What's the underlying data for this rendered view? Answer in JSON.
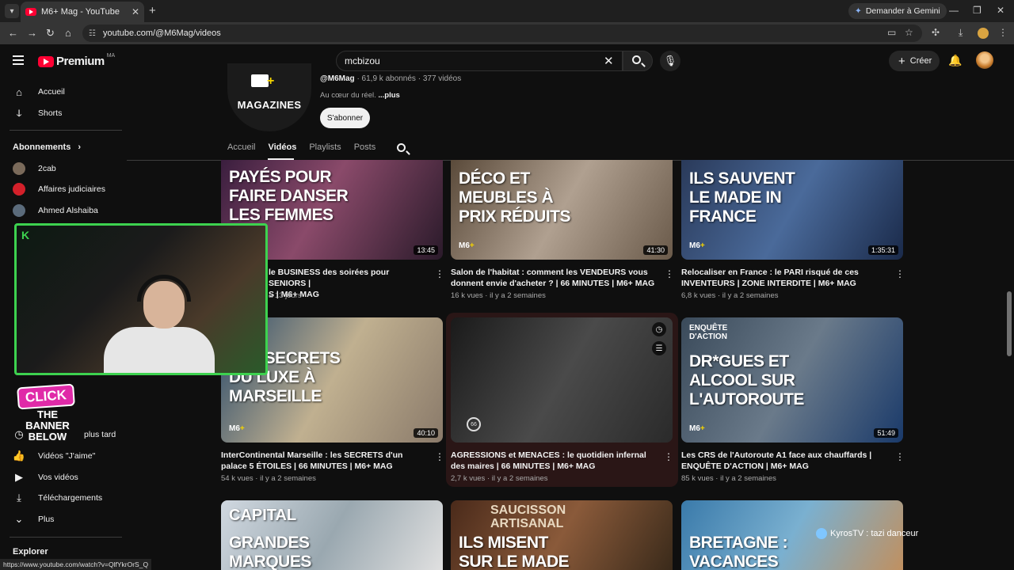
{
  "browser": {
    "tab_title": "M6+ Mag - YouTube",
    "url": "youtube.com/@M6Mag/videos",
    "gemini_label": "Demander à Gemini",
    "status_url": "https://www.youtube.com/watch?v=QlfYkrOrS_Q"
  },
  "header": {
    "logo_text": "Premium",
    "logo_region": "MA",
    "search_value": "mcbizou",
    "create_label": "Créer"
  },
  "sidebar": {
    "top_items": [
      {
        "label": "Accueil",
        "icon": "home-icon"
      },
      {
        "label": "Shorts",
        "icon": "shorts-icon"
      }
    ],
    "subscriptions_heading": "Abonnements",
    "subscriptions": [
      {
        "label": "2cab",
        "color": "#7a6a5a"
      },
      {
        "label": "Affaires judiciaires",
        "color": "#d3202a"
      },
      {
        "label": "Ahmed Alshaiba",
        "color": "#5b6b7b"
      }
    ],
    "you_items": [
      {
        "label": "À regarder plus tard",
        "icon": "clock-icon"
      },
      {
        "label": "Vidéos \"J'aime\"",
        "icon": "thumb-up-icon"
      },
      {
        "label": "Vos vidéos",
        "icon": "play-square-icon"
      },
      {
        "label": "Téléchargements",
        "icon": "download-icon"
      },
      {
        "label": "Plus",
        "icon": "chevron-down-icon"
      }
    ],
    "explore_heading": "Explorer",
    "partial_later_label": "plus tard"
  },
  "channel": {
    "logo_text": "MAGAZINES",
    "handle": "@M6Mag",
    "meta": "· 61,9 k abonnés · 377 vidéos",
    "description": "Au cœur du réel.",
    "more_label": "...plus",
    "subscribe_label": "S'abonner",
    "tabs": [
      "Accueil",
      "Vidéos",
      "Playlists",
      "Posts"
    ],
    "active_tab": "Vidéos"
  },
  "videos": [
    {
      "thumb_title": "Payés pour faire danser les femmes",
      "duration": "13:45",
      "title_partial": "le BUSINESS des soirées pour SENIORS |",
      "title_line2_partial": "S | M6+ MAG",
      "meta_partial": "a 13 jours",
      "bg": "linear-gradient(120deg,#3a1e3e,#8a4a6a 45%,#2a1a2a)"
    },
    {
      "thumb_title": "Déco et meubles à prix réduits",
      "duration": "41:30",
      "title": "Salon de l'habitat : comment les VENDEURS vous donnent envie d'acheter ? | 66 MINUTES | M6+ MAG",
      "meta": "16 k vues · il y a 2 semaines",
      "bg": "linear-gradient(120deg,#5a4a3a,#b0a090 50%,#6a5a4a)"
    },
    {
      "thumb_title": "Ils sauvent le made in France",
      "duration": "1:35:31",
      "title": "Relocaliser en France : le PARI risqué de ces INVENTEURS | ZONE INTERDITE | M6+ MAG",
      "meta": "6,8 k vues · il y a 2 semaines",
      "bg": "linear-gradient(120deg,#2a3a5a,#4a6a9a 50%,#1a2a4a)"
    },
    {
      "thumb_title": "Les secrets du luxe à Marseille",
      "duration": "40:10",
      "title": "InterContinental Marseille : les SECRETS d'un palace 5 ÉTOILES | 66 MINUTES | M6+ MAG",
      "meta": "54 k vues · il y a 2 semaines",
      "bg": "linear-gradient(120deg,#2a4a6a,#c0b090 50%,#8a7a6a)"
    },
    {
      "thumb_title": "",
      "duration": "",
      "title": "AGRESSIONS et MENACES : le quotidien infernal des maires | 66 MINUTES | M6+ MAG",
      "meta": "2,7 k vues · il y a 2 semaines",
      "bg": "linear-gradient(120deg,#1a1a1a,#4a4a4a 50%,#2a2a2a)"
    },
    {
      "thumb_title": "Dr*gues et alcool sur l'autoroute",
      "kicker": "ENQUÊTE D'ACTION",
      "duration": "51:49",
      "title": "Les CRS de l'Autoroute A1 face aux chauffards | ENQUÊTE D'ACTION | M6+ MAG",
      "meta": "85 k vues · il y a 2 semaines",
      "bg": "linear-gradient(120deg,#3a4a5a,#6a7a8a 50%,#1a3a6a)"
    },
    {
      "thumb_title": "Grandes marques",
      "kicker": "CAPITAL",
      "duration": "",
      "title": "",
      "meta": "",
      "bg": "linear-gradient(120deg,#d0d8e0,#9aa8b0 50%,#e0e0e0)"
    },
    {
      "thumb_title": "Ils misent sur le made",
      "kicker": "SAUCISSON ARTISANAL",
      "duration": "",
      "title": "",
      "meta": "",
      "bg": "linear-gradient(120deg,#4a2a1a,#8a5a3a 50%,#3a2a1a)"
    },
    {
      "thumb_title": "Bretagne : vacances",
      "duration": "",
      "title": "",
      "meta": "",
      "bg": "linear-gradient(120deg,#3a7aaa,#7ab0d0 50%,#c09060)"
    }
  ],
  "overlay": {
    "webcam_badge": "K",
    "click_label": "CLICK",
    "banner_text": "THE BANNER BELOW",
    "kyros_label": "KyrosTV : tazi danceur"
  }
}
